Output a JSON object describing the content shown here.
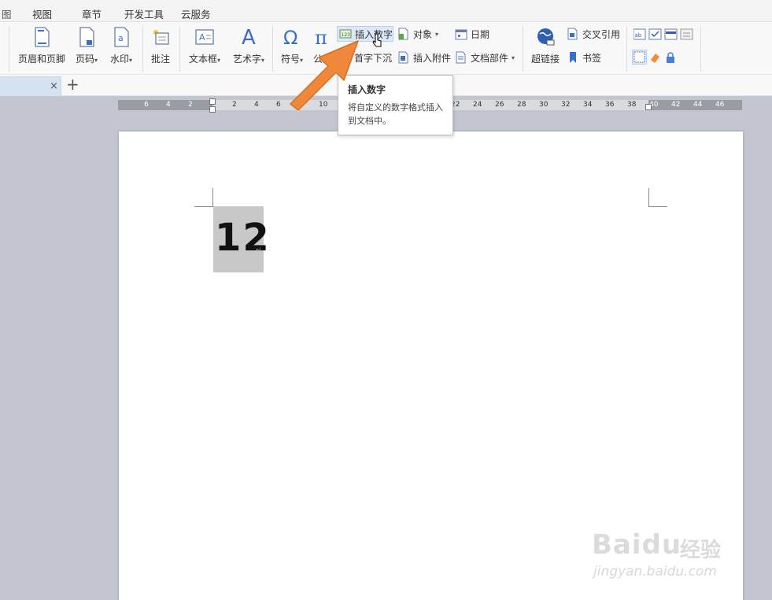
{
  "menu": [
    "视图",
    "章节",
    "开发工具",
    "云服务"
  ],
  "ribbon": {
    "header_footer": "页眉和页脚",
    "page_number": "页码",
    "watermark": "水印",
    "comment": "批注",
    "text_box": "文本框",
    "word_art": "艺术字",
    "symbol": "符号",
    "formula": "公式",
    "insert_number": "插入数字",
    "object": "对象",
    "date": "日期",
    "drop_cap": "首字下沉",
    "insert_attachment": "插入附件",
    "doc_parts": "文档部件",
    "hyperlink": "超链接",
    "cross_reference": "交叉引用",
    "bookmark": "书签"
  },
  "tab": {
    "close": "×",
    "add": "+"
  },
  "ruler": [
    "6",
    "4",
    "2",
    "2",
    "4",
    "6",
    "10",
    "22",
    "24",
    "26",
    "28",
    "30",
    "32",
    "34",
    "36",
    "38",
    "40",
    "42",
    "44",
    "46"
  ],
  "document": {
    "field_value": "12",
    "paragraph_mark": "↵"
  },
  "tooltip": {
    "title": "插入数字",
    "description": "将自定义的数字格式插入到文档中。"
  },
  "watermark": {
    "logo": "Baidu",
    "logo_cn": "经验",
    "url": "jingyan.baidu.com"
  },
  "colors": {
    "arrow": "#f0883c",
    "accent": "#3a6fc4"
  }
}
